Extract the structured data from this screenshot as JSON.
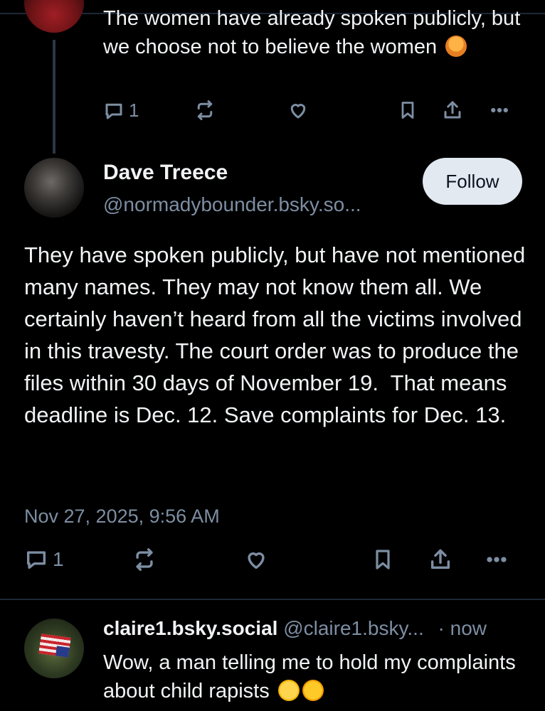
{
  "colors": {
    "background": "#000000",
    "text_primary": "#f1f3f5",
    "text_secondary": "#7d8ea3",
    "divider": "#1e2836",
    "follow_button_bg": "#e3e9f1"
  },
  "top_post": {
    "text": "The women have already spoken publicly, but we choose not to believe the women",
    "emoji": "person-shrugging",
    "actions": {
      "reply_count": "1",
      "icons": [
        "reply-icon",
        "repost-icon",
        "like-icon",
        "bookmark-icon",
        "share-icon",
        "more-icon"
      ]
    }
  },
  "main_post": {
    "author_name": "Dave Treece",
    "author_handle": "@normadybounder.bsky.so...",
    "follow_label": "Follow",
    "text": "They have spoken publicly, but have not mentioned many names. They may not know them all. We certainly haven’t heard from all the victims involved in this travesty. The court order was to produce the files within 30 days of November 19.  That means deadline is Dec. 12. Save complaints for Dec. 13.",
    "timestamp": "Nov 27, 2025, 9:56 AM",
    "actions": {
      "reply_count": "1",
      "icons": [
        "reply-icon",
        "repost-icon",
        "like-icon",
        "bookmark-icon",
        "share-icon",
        "more-icon"
      ]
    }
  },
  "reply_post": {
    "author_name": "claire1.bsky.social",
    "author_handle": "@claire1.bsky...",
    "separator": "·",
    "time": "now",
    "text": "Wow, a man telling me to hold my complaints about child rapists",
    "emojis": [
      "face-with-rolling-eyes",
      "yawning-face"
    ]
  }
}
